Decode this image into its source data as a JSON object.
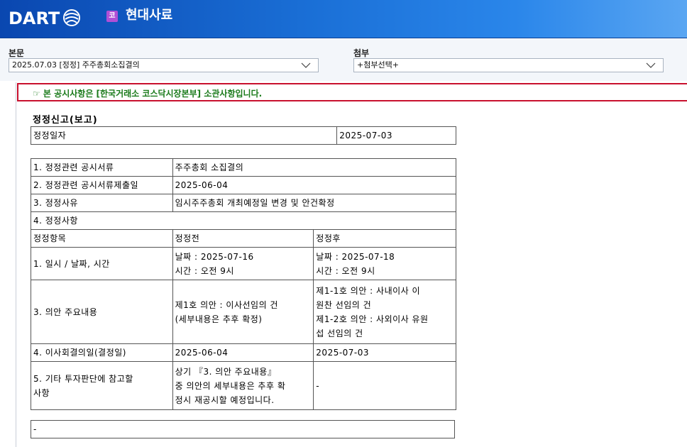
{
  "header": {
    "logo_text": "DART",
    "company_badge": "코",
    "company_name": "현대사료"
  },
  "toolbar": {
    "main_label": "본문",
    "main_select_value": "2025.07.03 [정정] 주주총회소집결의",
    "attach_label": "첨부",
    "attach_select_value": "+첨부선택+"
  },
  "notice": {
    "text": "☞ 본 공시사항은 [한국거래소 코스닥시장본부] 소관사항입니다."
  },
  "document": {
    "title": "정정신고(보고)",
    "date_row": {
      "label": "정정일자",
      "value": "2025-07-03"
    },
    "rows": {
      "r1": {
        "label": "1. 정정관련 공시서류",
        "value": "주주총회 소집결의"
      },
      "r2": {
        "label": "2. 정정관련 공시서류제출일",
        "value": "2025-06-04"
      },
      "r3": {
        "label": "3. 정정사유",
        "value": "임시주주총회 개최예정일 변경 및 안건확정"
      },
      "r4": {
        "label": "4. 정정사항"
      }
    },
    "columns": {
      "item": "정정항목",
      "before": "정정전",
      "after": "정정후"
    },
    "items": {
      "i1": {
        "label": "1. 일시 / 날짜, 시간",
        "before_1": "날짜 : 2025-07-16",
        "before_2": "시간 : 오전 9시",
        "after_1": "날짜 : 2025-07-18",
        "after_2": "시간 : 오전 9시"
      },
      "i2": {
        "label": "3. 의안 주요내용",
        "before_1": "제1호 의안 : 이사선임의 건",
        "before_2": "(세부내용은 추후 확정)",
        "after_1": "제1-1호 의안 : 사내이사 이",
        "after_2": "원찬 선임의 건",
        "after_3": "제1-2호 의안 : 사외이사 유원",
        "after_4": "섭 선임의 건"
      },
      "i3": {
        "label": "4. 이사회결의일(결정일)",
        "before": "2025-06-04",
        "after": "2025-07-03"
      },
      "i4": {
        "label_1": "5. 기타 투자판단에 참고할",
        "label_2": "사항",
        "before_1": "상기 『3. 의안 주요내용』",
        "before_2": "중 의안의 세부내용은 추후 확",
        "before_3": "정시 재공시할 예정입니다.",
        "after": "-"
      }
    },
    "footer_box": "-"
  },
  "colors": {
    "header_start": "#0a47b0",
    "header_end": "#5aa6f2",
    "notice_border": "#c8102e",
    "notice_text": "#1a7a1a",
    "badge": "#b04fd6"
  },
  "icons": {
    "logo_mark": "dart-globe-icon",
    "select_arrow": "chevron-down-icon"
  }
}
